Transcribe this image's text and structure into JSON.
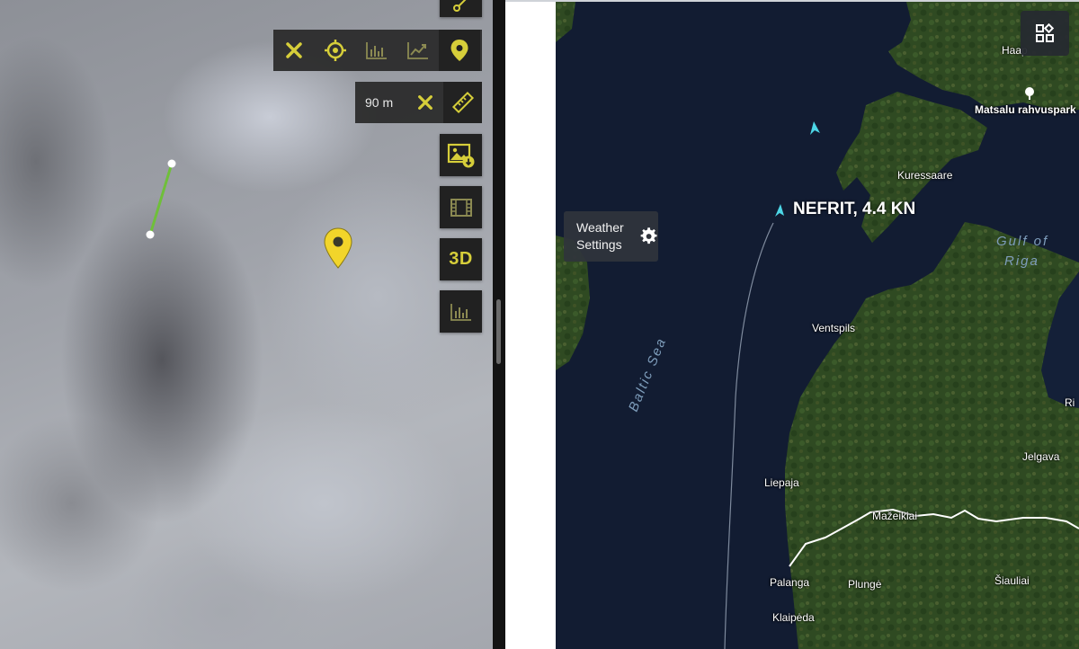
{
  "left_panel": {
    "toolbar": [
      {
        "name": "close",
        "icon": "close-icon"
      },
      {
        "name": "target",
        "icon": "crosshair-icon"
      },
      {
        "name": "bar-chart",
        "icon": "bar-chart-icon"
      },
      {
        "name": "trend-chart",
        "icon": "trend-chart-icon"
      },
      {
        "name": "location",
        "icon": "map-pin-icon"
      }
    ],
    "ruler": {
      "distance": "90 m"
    },
    "tools": {
      "three_d_label": "3D"
    },
    "accent_color": "#d6ce3a"
  },
  "map": {
    "vessel": {
      "label": "NEFRIT, 4.4 KN"
    },
    "weather_button": {
      "label_line1": "Weather",
      "label_line2": "Settings"
    },
    "places": {
      "haap": "Haap",
      "matsalu": "Matsalu rahvuspark",
      "kuressaare": "Kuressaare",
      "ventspils": "Ventspils",
      "ri": "Ri",
      "jelgava": "Jelgava",
      "liepaja": "Liepaja",
      "mazeikiai": "Mažeikiai",
      "palanga": "Palanga",
      "plunge": "Plungė",
      "siauliai": "Šiauliai",
      "klaipeda": "Klaipėda"
    },
    "water": {
      "gulf_line1": "Gulf of",
      "gulf_line2": "Riga",
      "sea": "Baltic Sea"
    },
    "sea_color": "#121c32",
    "land_color": "#2f4a22"
  }
}
